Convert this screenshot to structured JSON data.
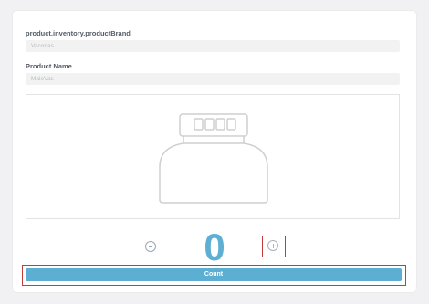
{
  "form": {
    "brand_label": "product.inventory.productBrand",
    "brand_value": "Vaconas",
    "product_name_label": "Product Name",
    "product_name_value": "MaleVas"
  },
  "image": {
    "icon": "jar-placeholder-icon"
  },
  "counter": {
    "value": "0",
    "decrement_icon": "minus-circle-icon",
    "increment_icon": "plus-circle-icon"
  },
  "actions": {
    "count_label": "Count"
  },
  "colors": {
    "accent": "#5caed2",
    "highlight": "#c83a3a"
  }
}
